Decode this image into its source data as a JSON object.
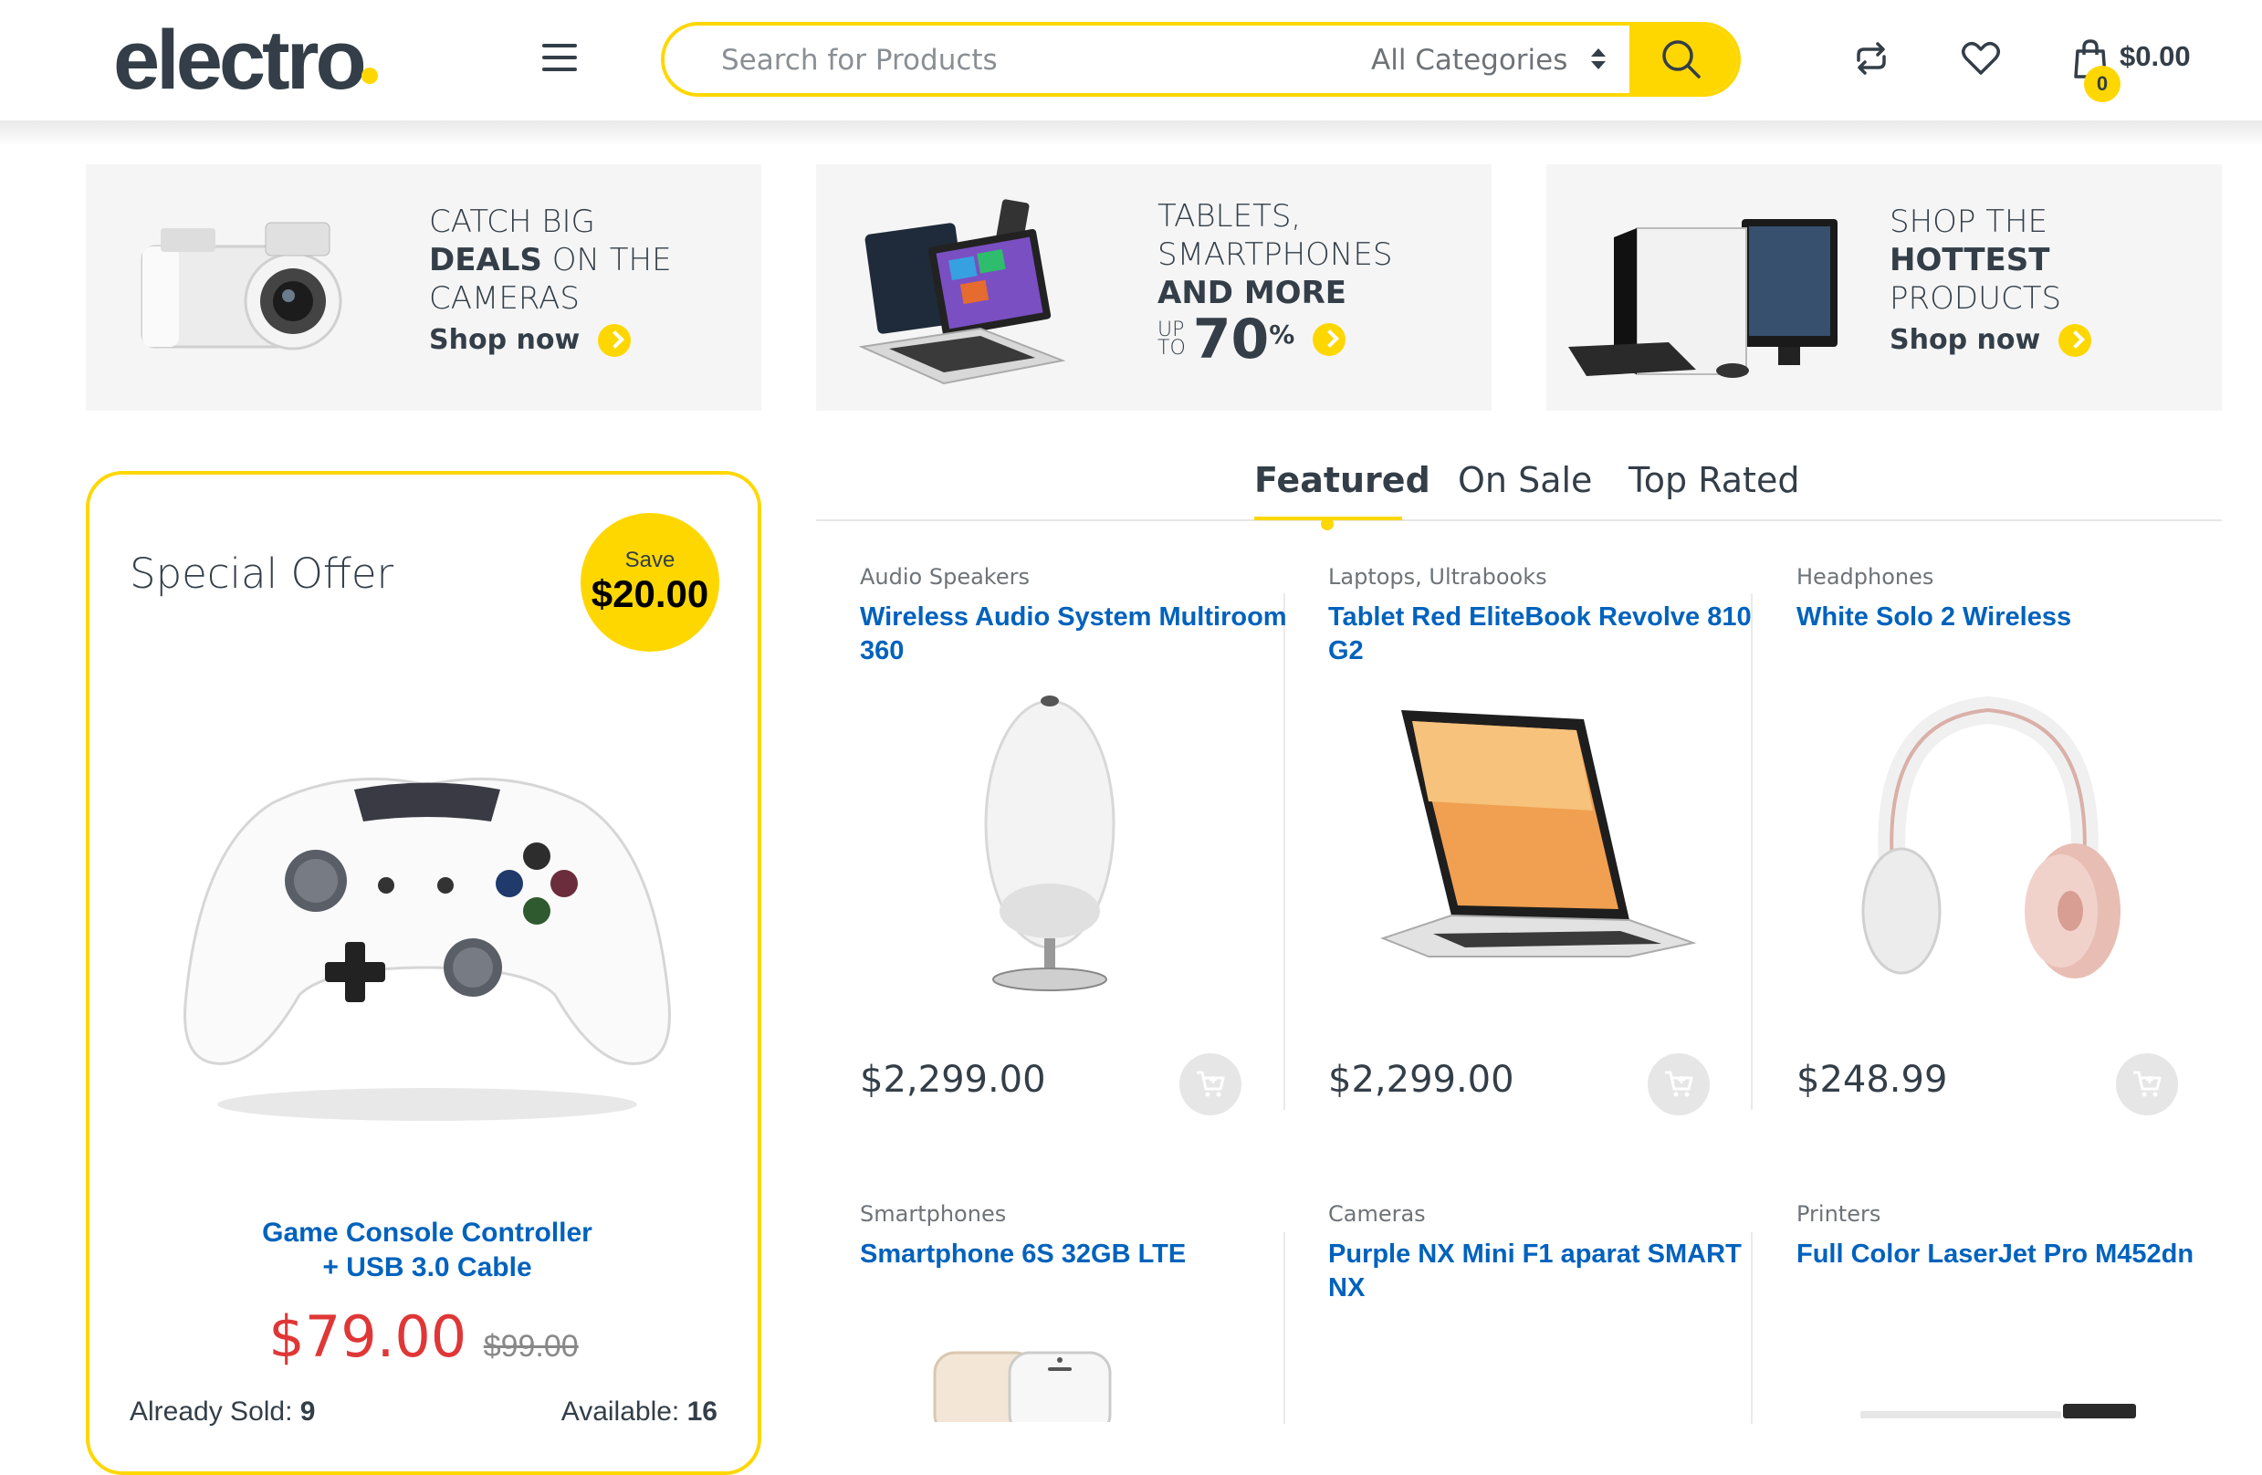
{
  "header": {
    "logo": "electro",
    "search_placeholder": "Search for Products",
    "category_selected": "All Categories",
    "cart_total": "$0.00",
    "cart_count": "0",
    "icons": [
      "menu-icon",
      "search-icon",
      "compare-icon",
      "heart-icon",
      "bag-icon"
    ],
    "accent_color": "#fed700"
  },
  "banners": [
    {
      "line1": "CATCH BIG",
      "bold": "DEALS",
      "line2_rest": " ON THE",
      "line3": "CAMERAS",
      "cta": "Shop now"
    },
    {
      "line1": "TABLETS,",
      "line2": "SMARTPHONES",
      "bold": "AND MORE",
      "upto_top": "UP",
      "upto_bottom": "TO",
      "upto_value": "70",
      "upto_unit": "%"
    },
    {
      "line1": "SHOP THE",
      "bold": "HOTTEST",
      "line3": "PRODUCTS",
      "cta": "Shop now"
    }
  ],
  "special_offer": {
    "title": "Special Offer",
    "save_label": "Save",
    "save_amount": "$20.00",
    "product_line1": "Game Console Controller",
    "product_line2": "+ USB 3.0 Cable",
    "price": "$79.00",
    "old_price": "$99.00",
    "sold_label": "Already Sold:",
    "sold_value": "9",
    "available_label": "Available:",
    "available_value": "16"
  },
  "tabs": [
    "Featured",
    "On Sale",
    "Top Rated"
  ],
  "products": [
    {
      "category": "Audio Speakers",
      "name": "Wireless Audio System Multiroom 360",
      "price": "$2,299.00"
    },
    {
      "category": "Laptops, Ultrabooks",
      "name": "Tablet Red EliteBook Revolve 810 G2",
      "price": "$2,299.00"
    },
    {
      "category": "Headphones",
      "name": "White Solo 2 Wireless",
      "price": "$248.99"
    },
    {
      "category": "Smartphones",
      "name": "Smartphone 6S 32GB LTE",
      "price": ""
    },
    {
      "category": "Cameras",
      "name": "Purple NX Mini F1 aparat SMART NX",
      "price": ""
    },
    {
      "category": "Printers",
      "name": "Full Color LaserJet Pro M452dn",
      "price": ""
    }
  ]
}
